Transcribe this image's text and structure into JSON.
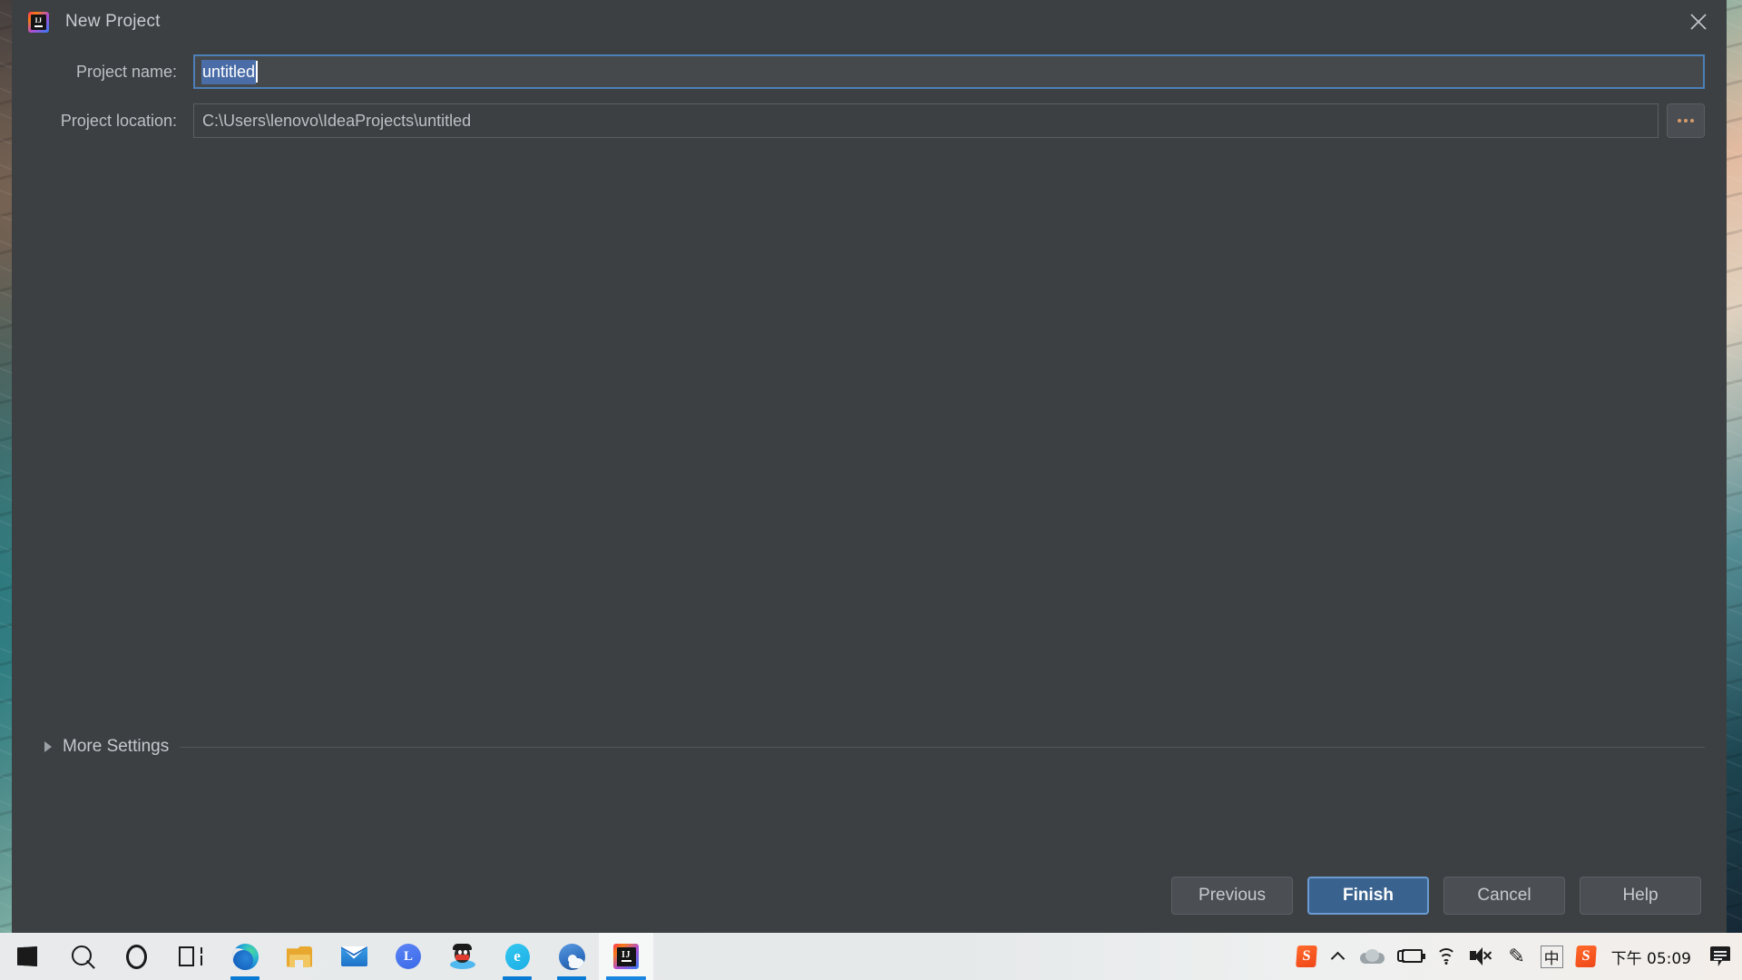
{
  "window": {
    "title": "New Project",
    "app_icon": "intellij-idea-icon",
    "close_icon": "close-icon"
  },
  "form": {
    "project_name": {
      "label": "Project name:",
      "value": "untitled",
      "selected": true
    },
    "project_location": {
      "label": "Project location:",
      "value": "C:\\Users\\lenovo\\IdeaProjects\\untitled",
      "browse_label": "..."
    }
  },
  "more_settings": {
    "label": "More Settings",
    "expanded": false,
    "chevron_icon": "triangle-right-icon"
  },
  "footer": {
    "buttons": [
      {
        "label": "Previous",
        "primary": false
      },
      {
        "label": "Finish",
        "primary": true
      },
      {
        "label": "Cancel",
        "primary": false
      },
      {
        "label": "Help",
        "primary": false
      }
    ]
  },
  "colors": {
    "dialog_bg": "#3c4043",
    "text": "#bfc3c7",
    "accent": "#3a628f",
    "focus_border": "#4d7fb8",
    "selection": "#4a6da7",
    "taskbar_bg": "#e8eaec",
    "taskbar_underline": "#0a7bd4"
  },
  "taskbar": {
    "items": [
      {
        "name": "start-button",
        "icon": "windows-logo-icon",
        "running": false,
        "active": false
      },
      {
        "name": "search-button",
        "icon": "search-icon",
        "running": false,
        "active": false
      },
      {
        "name": "cortana-button",
        "icon": "cortana-icon",
        "running": false,
        "active": false
      },
      {
        "name": "task-view-button",
        "icon": "task-view-icon",
        "running": false,
        "active": false
      },
      {
        "name": "edge-button",
        "icon": "edge-icon",
        "running": true,
        "active": false
      },
      {
        "name": "file-explorer-button",
        "icon": "folder-icon",
        "running": false,
        "active": false
      },
      {
        "name": "mail-button",
        "icon": "mail-icon",
        "running": false,
        "active": false
      },
      {
        "name": "clock-app-button",
        "icon": "blue-circle-l-icon",
        "running": false,
        "active": false
      },
      {
        "name": "qq-button",
        "icon": "qq-penguin-icon",
        "running": false,
        "active": false
      },
      {
        "name": "editor-button",
        "icon": "teal-e-icon",
        "running": true,
        "active": false
      },
      {
        "name": "cloud-app-button",
        "icon": "cloud-ball-icon",
        "running": true,
        "active": false
      },
      {
        "name": "intellij-button",
        "icon": "intellij-idea-icon",
        "running": true,
        "active": true
      }
    ],
    "tray": [
      {
        "name": "sogou-input-tray",
        "icon": "sogou-s-icon",
        "label": "S"
      },
      {
        "name": "show-hidden-icons",
        "icon": "chevron-up-icon",
        "label": ""
      },
      {
        "name": "onedrive-tray",
        "icon": "onedrive-cloud-icon",
        "label": ""
      },
      {
        "name": "battery-tray",
        "icon": "battery-charging-icon",
        "label": ""
      },
      {
        "name": "network-tray",
        "icon": "wifi-icon",
        "label": ""
      },
      {
        "name": "volume-tray",
        "icon": "speaker-muted-icon",
        "label": ""
      },
      {
        "name": "pen-tray",
        "icon": "pen-ink-icon",
        "label": ""
      },
      {
        "name": "ime-mode-tray",
        "icon": "ime-chinese-icon",
        "label": "中"
      },
      {
        "name": "sogou-pinyin-tray",
        "icon": "sogou-s-icon",
        "label": "S"
      }
    ],
    "clock": "下午 05:09",
    "notification_icon": "notification-center-icon"
  }
}
